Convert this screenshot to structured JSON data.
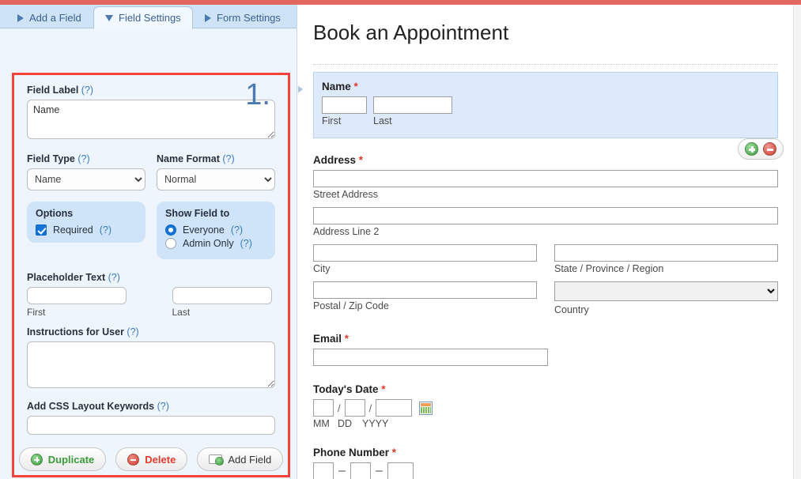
{
  "tabs": [
    {
      "label": "Add a Field",
      "icon": "triangle-right-icon",
      "active": false
    },
    {
      "label": "Field Settings",
      "icon": "triangle-down-icon",
      "active": true
    },
    {
      "label": "Form Settings",
      "icon": "triangle-right-icon",
      "active": false
    }
  ],
  "settings": {
    "step_number": "1.",
    "field_label": {
      "label": "Field Label",
      "hint": "(?)",
      "value": "Name"
    },
    "field_type": {
      "label": "Field Type",
      "hint": "(?)",
      "value": "Name"
    },
    "name_format": {
      "label": "Name Format",
      "hint": "(?)",
      "value": "Normal"
    },
    "options": {
      "title": "Options",
      "required": {
        "label": "Required",
        "hint": "(?)",
        "checked": true
      }
    },
    "show_field_to": {
      "title": "Show Field to",
      "everyone": {
        "label": "Everyone",
        "hint": "(?)",
        "selected": true
      },
      "admin_only": {
        "label": "Admin Only",
        "hint": "(?)",
        "selected": false
      }
    },
    "placeholder_text": {
      "label": "Placeholder Text",
      "hint": "(?)",
      "first": {
        "caption": "First",
        "value": ""
      },
      "last": {
        "caption": "Last",
        "value": ""
      }
    },
    "instructions": {
      "label": "Instructions for User",
      "hint": "(?)",
      "value": ""
    },
    "css_keywords": {
      "label": "Add CSS Layout Keywords",
      "hint": "(?)",
      "value": ""
    },
    "buttons": {
      "duplicate": "Duplicate",
      "delete": "Delete",
      "add_field": "Add Field"
    }
  },
  "preview": {
    "title": "Book an Appointment",
    "name": {
      "label": "Name",
      "required_mark": "*",
      "first_caption": "First",
      "last_caption": "Last",
      "first_value": "",
      "last_value": ""
    },
    "address": {
      "label": "Address",
      "required_mark": "*",
      "street_caption": "Street Address",
      "line2_caption": "Address Line 2",
      "city_caption": "City",
      "state_caption": "State / Province / Region",
      "postal_caption": "Postal / Zip Code",
      "country_caption": "Country",
      "country_value": ""
    },
    "email": {
      "label": "Email",
      "required_mark": "*",
      "value": ""
    },
    "todays_date": {
      "label": "Today's Date",
      "required_mark": "*",
      "mm_caption": "MM",
      "dd_caption": "DD",
      "yyyy_caption": "YYYY",
      "sep1": "/",
      "sep2": "/",
      "calendar_icon": "calendar-icon"
    },
    "phone_number": {
      "label": "Phone Number",
      "required_mark": "*",
      "sep1": "–",
      "sep2": "–"
    },
    "row_controls": {
      "add_icon": "plus-circle-icon",
      "remove_icon": "minus-circle-icon"
    }
  },
  "colors": {
    "accent_red": "#f4433c",
    "top_bar": "#e2685f",
    "panel_blue": "#cfe4f8",
    "selected_row": "#ddeafb",
    "tab_text": "#3a6090",
    "required_star": "#e03a2f"
  }
}
